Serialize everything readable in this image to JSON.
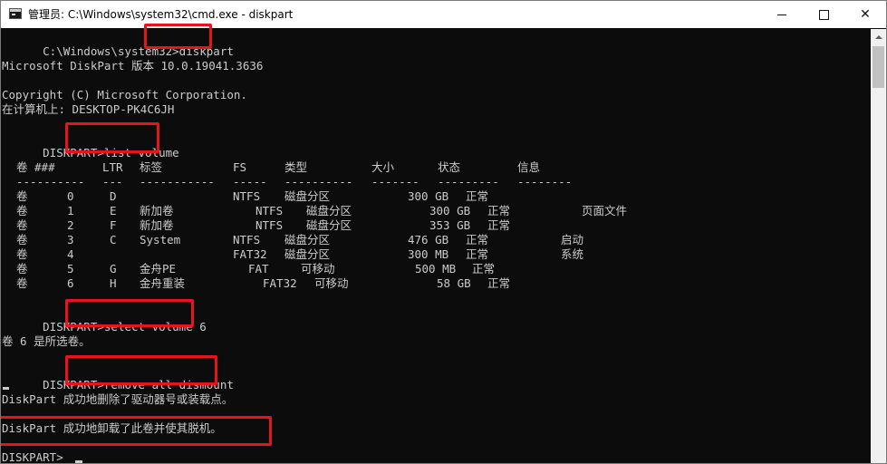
{
  "window": {
    "title": "管理员: C:\\Windows\\system32\\cmd.exe - diskpart"
  },
  "console": {
    "prompt_cmd_dir": "C:\\Windows\\system32>",
    "cmd_diskpart": "diskpart",
    "version_line": "Microsoft DiskPart 版本 10.0.19041.3636",
    "copyright_line": "Copyright (C) Microsoft Corporation.",
    "computer_line": "在计算机上: DESKTOP-PK4C6JH",
    "diskpart_prompt": "DISKPART>",
    "cmd_list_volume": "list volume",
    "cmd_select_volume": "select volume 6",
    "select_result": "卷 6 是所选卷。",
    "cmd_remove": "remove all dismount",
    "remove_result_1": "DiskPart 成功地删除了驱动器号或装载点。",
    "remove_result_2": "DiskPart 成功地卸载了此卷并使其脱机。",
    "final_prompt": "DISKPART> "
  },
  "volume_table": {
    "headers": {
      "vol": "卷 ###",
      "ltr": "LTR",
      "label": "标签",
      "fs": "FS",
      "type": "类型",
      "size": "大小",
      "status": "状态",
      "info": "信息"
    },
    "separators": {
      "vol": "----------",
      "ltr": "---",
      "label": "-----------",
      "fs": "-----",
      "type": "----------",
      "size": "-------",
      "status": "---------",
      "info": "--------"
    },
    "rows": [
      {
        "vol": "卷",
        "num": "0",
        "ltr": "D",
        "label": "",
        "fs": "NTFS",
        "type": "磁盘分区",
        "size": "300 GB",
        "status": "正常",
        "info": ""
      },
      {
        "vol": "卷",
        "num": "1",
        "ltr": "E",
        "label": "新加卷",
        "fs": "NTFS",
        "type": "磁盘分区",
        "size": "300 GB",
        "status": "正常",
        "info": "页面文件"
      },
      {
        "vol": "卷",
        "num": "2",
        "ltr": "F",
        "label": "新加卷",
        "fs": "NTFS",
        "type": "磁盘分区",
        "size": "353 GB",
        "status": "正常",
        "info": ""
      },
      {
        "vol": "卷",
        "num": "3",
        "ltr": "C",
        "label": "System",
        "fs": "NTFS",
        "type": "磁盘分区",
        "size": "476 GB",
        "status": "正常",
        "info": "启动"
      },
      {
        "vol": "卷",
        "num": "4",
        "ltr": "",
        "label": "",
        "fs": "FAT32",
        "type": "磁盘分区",
        "size": "300 MB",
        "status": "正常",
        "info": "系统"
      },
      {
        "vol": "卷",
        "num": "5",
        "ltr": "G",
        "label": "金舟PE",
        "fs": "FAT",
        "type": "可移动",
        "size": "500 MB",
        "status": "正常",
        "info": ""
      },
      {
        "vol": "卷",
        "num": "6",
        "ltr": "H",
        "label": "金舟重装",
        "fs": "FAT32",
        "type": "可移动",
        "size": "58 GB",
        "status": "正常",
        "info": ""
      }
    ]
  },
  "colors": {
    "console_bg": "#0c0c0c",
    "console_text": "#cccccc",
    "highlight": "#e8141b",
    "titlebar_bg": "#ffffff"
  }
}
